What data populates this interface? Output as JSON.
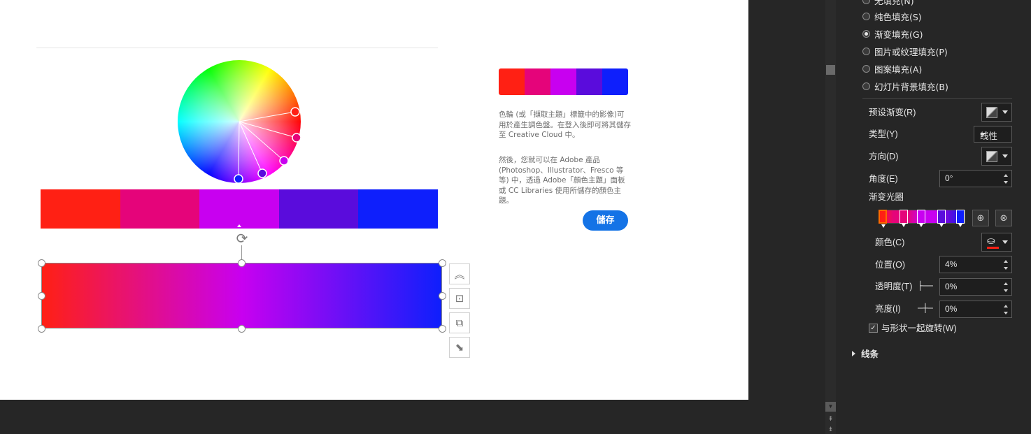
{
  "slide": {
    "wheel_label": "color wheel",
    "swatches": [
      "#ff2014",
      "#e5047a",
      "#c800f0",
      "#5a0cdc",
      "#0e1ffc"
    ],
    "gradient": {
      "stops": [
        "#ff2014",
        "#c800f0",
        "#0e1ffc"
      ]
    }
  },
  "floating_tools": {
    "icons": [
      "collapse-up-icon",
      "center-align-icon",
      "arrange-icon",
      "resize-icon"
    ]
  },
  "adobe_panel": {
    "palette": [
      "#ff2014",
      "#e5047a",
      "#c800f0",
      "#5a0cdc",
      "#0e1ffc"
    ],
    "desc1": "色輪 (或「擷取主題」標籤中的影像)可用於產生調色盤。在登入後即可將其儲存至 Creative Cloud 中。",
    "desc2": "然後，您就可以在 Adobe 產品 (Photoshop、Illustrator、Fresco 等等) 中，透過 Adobe「顏色主題」面板或 CC Libraries 使用所儲存的顏色主題。",
    "save_label": "儲存",
    "save_color": "#1473e6"
  },
  "format_pane": {
    "fill_options": [
      {
        "label": "无填充(N)",
        "checked": false
      },
      {
        "label": "纯色填充(S)",
        "checked": false
      },
      {
        "label": "渐变填充(G)",
        "checked": true
      },
      {
        "label": "图片或纹理填充(P)",
        "checked": false
      },
      {
        "label": "图案填充(A)",
        "checked": false
      },
      {
        "label": "幻灯片背景填充(B)",
        "checked": false
      }
    ],
    "preset_label": "预设渐变(R)",
    "type_label": "类型(Y)",
    "type_value": "线性",
    "direction_label": "方向(D)",
    "angle_label": "角度(E)",
    "angle_value": "0°",
    "stops_label": "渐变光圈",
    "stops": [
      "#ff2014",
      "#e5047a",
      "#e5047a",
      "#c800f0",
      "#c800f0",
      "#5a0cdc",
      "#0e1ffc"
    ],
    "color_label": "颜色(C)",
    "position_label": "位置(O)",
    "position_value": "4%",
    "transparency_label": "透明度(T)",
    "transparency_value": "0%",
    "brightness_label": "亮度(I)",
    "brightness_value": "0%",
    "rotate_label": "与形状一起旋转(W)",
    "rotate_checked": true,
    "line_section": "线条"
  }
}
